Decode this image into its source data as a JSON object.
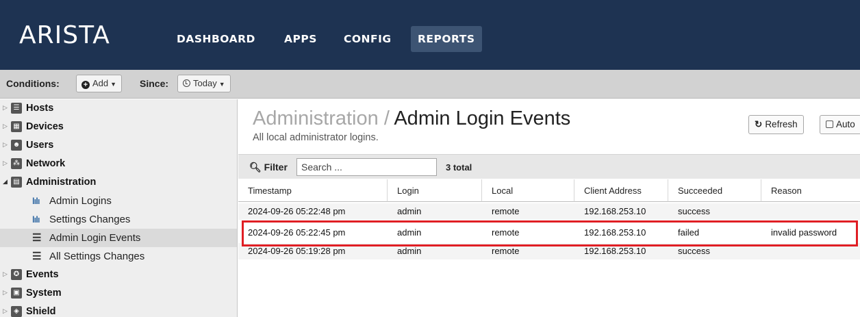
{
  "nav": {
    "logo": "ARISTA",
    "tabs": [
      "DASHBOARD",
      "APPS",
      "CONFIG",
      "REPORTS"
    ],
    "active_tab": "REPORTS"
  },
  "conditions": {
    "label": "Conditions:",
    "add_label": "Add",
    "since_label": "Since:",
    "since_value": "Today"
  },
  "sidebar": {
    "items": [
      {
        "label": "Hosts",
        "icon": "hosts-icon",
        "expanded": false
      },
      {
        "label": "Devices",
        "icon": "devices-icon",
        "expanded": false
      },
      {
        "label": "Users",
        "icon": "users-icon",
        "expanded": false
      },
      {
        "label": "Network",
        "icon": "network-icon",
        "expanded": false
      },
      {
        "label": "Administration",
        "icon": "administration-icon",
        "expanded": true
      },
      {
        "label": "Events",
        "icon": "events-icon",
        "expanded": false
      },
      {
        "label": "System",
        "icon": "system-icon",
        "expanded": false
      },
      {
        "label": "Shield",
        "icon": "shield-icon",
        "expanded": false
      }
    ],
    "children": [
      {
        "label": "Admin Logins",
        "icon": "bar-chart-icon",
        "selected": false
      },
      {
        "label": "Settings Changes",
        "icon": "bar-chart-icon",
        "selected": false
      },
      {
        "label": "Admin Login Events",
        "icon": "list-icon",
        "selected": true
      },
      {
        "label": "All Settings Changes",
        "icon": "list-icon",
        "selected": false
      }
    ]
  },
  "main": {
    "breadcrumb_parent": "Administration",
    "breadcrumb_separator": "/",
    "title": "Admin Login Events",
    "subtitle": "All local administrator logins.",
    "refresh_label": "Refresh",
    "auto_label": "Auto",
    "filter_label": "Filter",
    "filter_placeholder": "Search ...",
    "total": "3 total"
  },
  "table": {
    "columns": [
      "Timestamp",
      "Login",
      "Local",
      "Client Address",
      "Succeeded",
      "Reason"
    ],
    "rows": [
      [
        "2024-09-26 05:22:48 pm",
        "admin",
        "remote",
        "192.168.253.10",
        "success",
        ""
      ],
      [
        "2024-09-26 05:22:45 pm",
        "admin",
        "remote",
        "192.168.253.10",
        "failed",
        "invalid password"
      ],
      [
        "2024-09-26 05:19:28 pm",
        "admin",
        "remote",
        "192.168.253.10",
        "success",
        ""
      ]
    ],
    "highlighted_row": 1
  },
  "colors": {
    "nav_bg": "#1e3352",
    "highlight": "#e01e24"
  }
}
